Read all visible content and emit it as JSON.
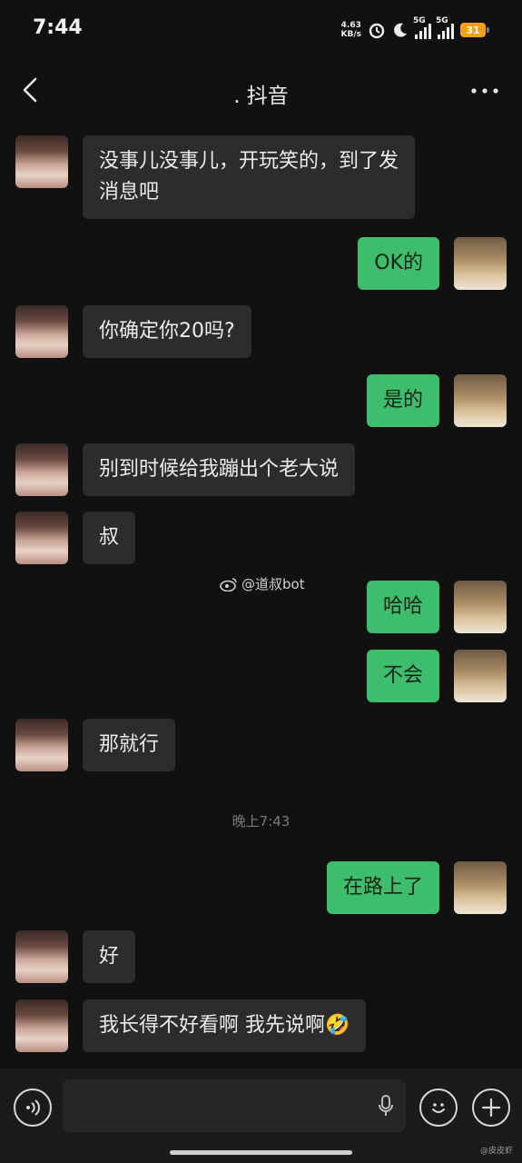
{
  "status_bar": {
    "time": "7:44",
    "net_speed_value": "4.63",
    "net_speed_unit": "KB/s",
    "signal1_label": "5G",
    "signal2_label": "5G",
    "battery": "31"
  },
  "nav": {
    "title": ". 抖音"
  },
  "messages": [
    {
      "side": "in",
      "text": "没事儿没事儿，开玩笑的，到了发\n消息吧"
    },
    {
      "side": "out",
      "text": "OK的"
    },
    {
      "side": "in",
      "text": "你确定你20吗?"
    },
    {
      "side": "out",
      "text": "是的"
    },
    {
      "side": "in",
      "text": "别到时候给我蹦出个老大说"
    },
    {
      "side": "in",
      "text": "叔"
    },
    {
      "side": "out",
      "text": "哈哈"
    },
    {
      "side": "out",
      "text": "不会"
    },
    {
      "side": "in",
      "text": "那就行"
    },
    {
      "side": "out",
      "text": "在路上了"
    },
    {
      "side": "in",
      "text": "好"
    },
    {
      "side": "in",
      "text": "我长得不好看啊 我先说啊",
      "emoji": "🤣"
    }
  ],
  "watermark": "@道叔bot",
  "timestamp": "晚上7:43",
  "corner_mark": "@皮皮虾"
}
